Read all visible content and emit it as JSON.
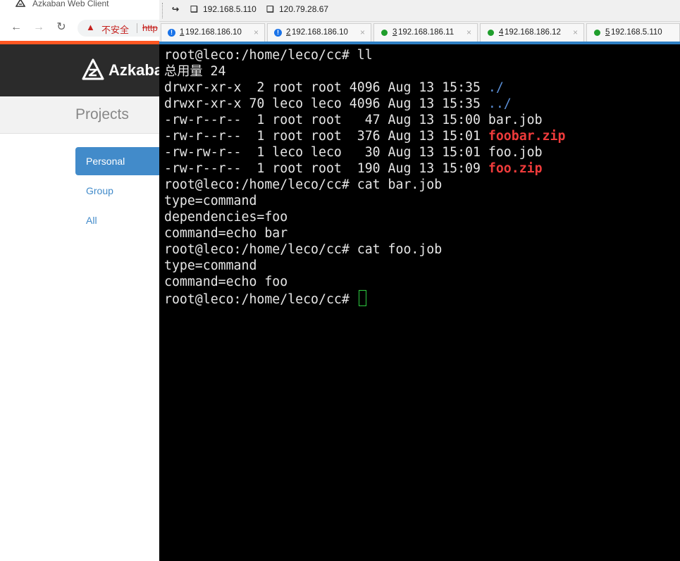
{
  "browser": {
    "window_title": "Azkaban Web Client",
    "security_warning": "不安全",
    "url_fragment": "http",
    "brand": "Azkaban",
    "section_title": "Projects",
    "filters": [
      "Personal",
      "Group",
      "All"
    ],
    "active_filter": "Personal"
  },
  "ssh_client": {
    "favorites": [
      "192.168.5.110",
      "120.79.28.67"
    ],
    "tabs": [
      {
        "num": "1",
        "host": "192.168.186.10",
        "status": "warning"
      },
      {
        "num": "2",
        "host": "192.168.186.10",
        "status": "warning"
      },
      {
        "num": "3",
        "host": "192.168.186.11",
        "status": "connected"
      },
      {
        "num": "4",
        "host": "192.168.186.12",
        "status": "connected"
      },
      {
        "num": "5",
        "host": "192.168.5.110",
        "status": "connected"
      }
    ],
    "colors": {
      "accent": "#2e7fc4",
      "warning": "#1a73e8",
      "connected": "#1f9e2c",
      "zip": "#ef3b3b",
      "dir": "#5b8fd6",
      "cursor": "#2ecc40"
    },
    "terminal": {
      "lines": [
        {
          "text": "root@leco:/home/leco/cc# ll"
        },
        {
          "text": "总用量 24"
        },
        {
          "text": "drwxr-xr-x  2 root root 4096 Aug 13 15:35 ",
          "name": "./",
          "kind": "dir"
        },
        {
          "text": "drwxr-xr-x 70 leco leco 4096 Aug 13 15:35 ",
          "name": "../",
          "kind": "dir"
        },
        {
          "text": "-rw-r--r--  1 root root   47 Aug 13 15:00 ",
          "name": "bar.job",
          "kind": "file"
        },
        {
          "text": "-rw-r--r--  1 root root  376 Aug 13 15:01 ",
          "name": "foobar.zip",
          "kind": "zip"
        },
        {
          "text": "-rw-rw-r--  1 leco leco   30 Aug 13 15:01 ",
          "name": "foo.job",
          "kind": "file"
        },
        {
          "text": "-rw-r--r--  1 root root  190 Aug 13 15:09 ",
          "name": "foo.zip",
          "kind": "zip"
        },
        {
          "text": "root@leco:/home/leco/cc# cat bar.job"
        },
        {
          "text": "type=command"
        },
        {
          "text": "dependencies=foo"
        },
        {
          "text": "command=echo bar"
        },
        {
          "text": "root@leco:/home/leco/cc# cat foo.job"
        },
        {
          "text": "type=command"
        },
        {
          "text": "command=echo foo"
        },
        {
          "text": "root@leco:/home/leco/cc# ",
          "cursor": true
        }
      ]
    }
  }
}
